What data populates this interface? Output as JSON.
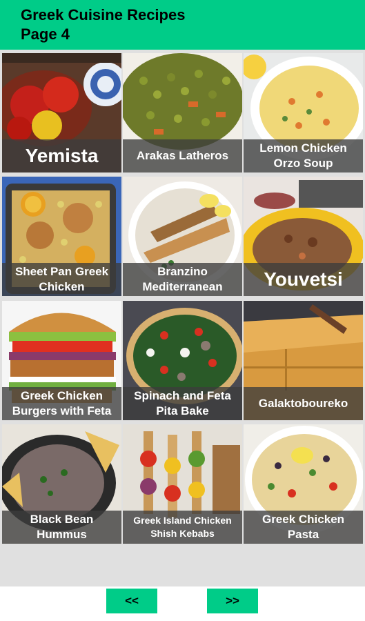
{
  "header": {
    "line1": "Greek Cuisine Recipes",
    "line2": "Page 4"
  },
  "tiles": [
    {
      "label": "Yemista"
    },
    {
      "label": "Arakas Latheros"
    },
    {
      "label": "Lemon Chicken Orzo Soup"
    },
    {
      "label": "Sheet Pan Greek Chicken"
    },
    {
      "label": "Branzino Mediterranean"
    },
    {
      "label": "Youvetsi"
    },
    {
      "label": "Greek Chicken Burgers with Feta"
    },
    {
      "label": "Spinach and Feta Pita Bake"
    },
    {
      "label": "Galaktoboureko"
    },
    {
      "label": "Black Bean Hummus"
    },
    {
      "label": "Greek Island Chicken Shish Kebabs"
    },
    {
      "label": "Greek Chicken Pasta"
    }
  ],
  "nav": {
    "prev_label": "<<",
    "next_label": ">>"
  },
  "colors": {
    "accent": "#00cc88",
    "overlay": "#3c3c3c"
  }
}
